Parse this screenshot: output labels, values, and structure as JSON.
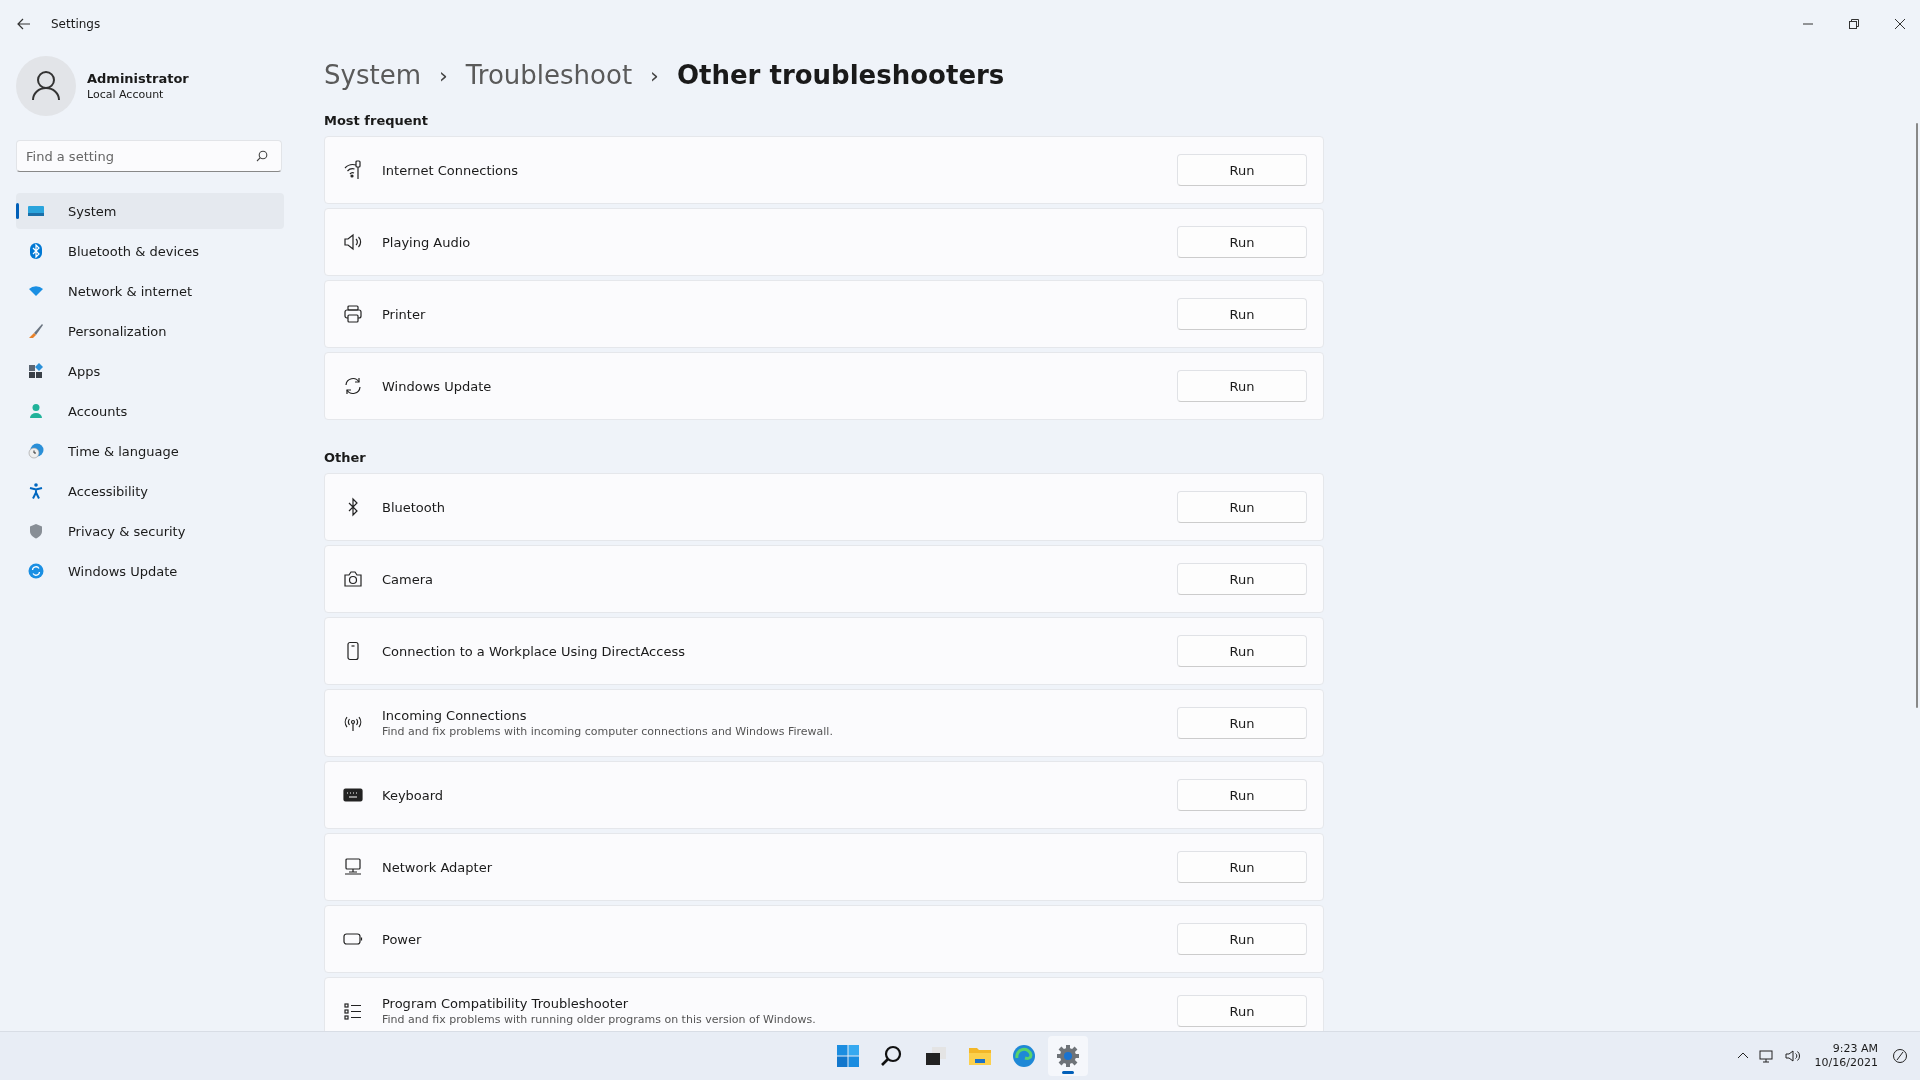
{
  "window": {
    "title": "Settings"
  },
  "account": {
    "name": "Administrator",
    "type": "Local Account"
  },
  "search": {
    "placeholder": "Find a setting"
  },
  "sidebar": {
    "items": [
      {
        "label": "System",
        "selected": true
      },
      {
        "label": "Bluetooth & devices",
        "selected": false
      },
      {
        "label": "Network & internet",
        "selected": false
      },
      {
        "label": "Personalization",
        "selected": false
      },
      {
        "label": "Apps",
        "selected": false
      },
      {
        "label": "Accounts",
        "selected": false
      },
      {
        "label": "Time & language",
        "selected": false
      },
      {
        "label": "Accessibility",
        "selected": false
      },
      {
        "label": "Privacy & security",
        "selected": false
      },
      {
        "label": "Windows Update",
        "selected": false
      }
    ]
  },
  "breadcrumb": [
    "System",
    "Troubleshoot",
    "Other troubleshooters"
  ],
  "breadcrumb_separator": "›",
  "sections": [
    {
      "title": "Most frequent",
      "items": [
        {
          "title": "Internet Connections",
          "button": "Run"
        },
        {
          "title": "Playing Audio",
          "button": "Run"
        },
        {
          "title": "Printer",
          "button": "Run"
        },
        {
          "title": "Windows Update",
          "button": "Run"
        }
      ]
    },
    {
      "title": "Other",
      "items": [
        {
          "title": "Bluetooth",
          "button": "Run"
        },
        {
          "title": "Camera",
          "button": "Run"
        },
        {
          "title": "Connection to a Workplace Using DirectAccess",
          "button": "Run"
        },
        {
          "title": "Incoming Connections",
          "description": "Find and fix problems with incoming computer connections and Windows Firewall.",
          "button": "Run"
        },
        {
          "title": "Keyboard",
          "button": "Run"
        },
        {
          "title": "Network Adapter",
          "button": "Run"
        },
        {
          "title": "Power",
          "button": "Run"
        },
        {
          "title": "Program Compatibility Troubleshooter",
          "description": "Find and fix problems with running older programs on this version of Windows.",
          "button": "Run"
        }
      ]
    }
  ],
  "taskbar": {
    "apps": [
      {
        "selected": false
      },
      {
        "selected": false
      },
      {
        "selected": false
      },
      {
        "selected": false
      },
      {
        "selected": false
      },
      {
        "selected": true
      }
    ],
    "time": "9:23 AM",
    "date": "10/16/2021"
  }
}
